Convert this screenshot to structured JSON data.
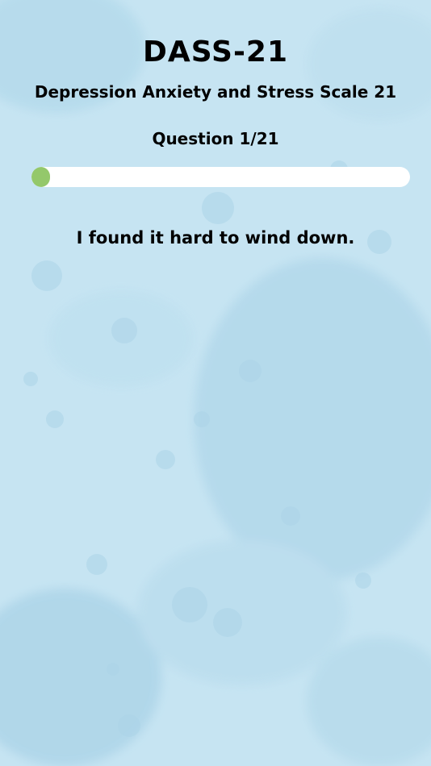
{
  "header": {
    "title": "DASS-21",
    "subtitle": "Depression Anxiety and Stress Scale 21"
  },
  "progress": {
    "counter_text": "Question 1/21",
    "current": 1,
    "total": 21,
    "fraction": 0.048
  },
  "question": {
    "text": "I found it hard to wind down."
  },
  "colors": {
    "background": "#c4e3f1",
    "progress_track": "#ffffff",
    "progress_fill": "#94c86b",
    "text": "#000000"
  }
}
